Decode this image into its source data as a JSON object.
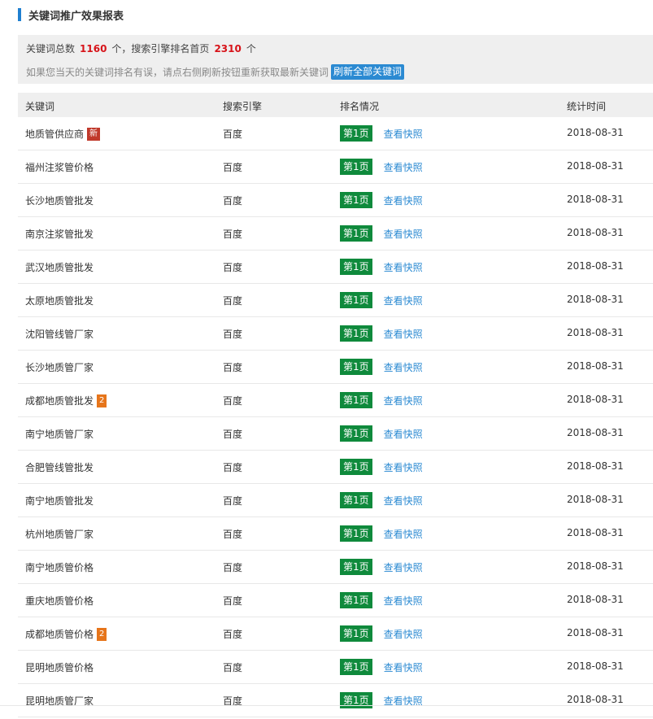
{
  "header": {
    "title": "关键词推广效果报表"
  },
  "summary": {
    "total_prefix": "关键词总数",
    "total_count": "1160",
    "mid_text": "个，搜索引擎排名首页",
    "first_page_count": "2310",
    "suffix": "个",
    "note": "如果您当天的关键词排名有误，请点右侧刷新按钮重新获取最新关键词",
    "refresh_label": "刷新全部关键词"
  },
  "table": {
    "headers": [
      "关键词",
      "搜索引擎",
      "排名情况",
      "统计时间"
    ],
    "snapshot_label": "查看快照",
    "rows": [
      {
        "keyword": "地质管供应商",
        "tag": "新",
        "tag_type": "new",
        "engine": "百度",
        "rank": "第1页",
        "date": "2018-08-31"
      },
      {
        "keyword": "福州注浆管价格",
        "tag": "",
        "engine": "百度",
        "rank": "第1页",
        "date": "2018-08-31"
      },
      {
        "keyword": "长沙地质管批发",
        "tag": "",
        "engine": "百度",
        "rank": "第1页",
        "date": "2018-08-31"
      },
      {
        "keyword": "南京注浆管批发",
        "tag": "",
        "engine": "百度",
        "rank": "第1页",
        "date": "2018-08-31"
      },
      {
        "keyword": "武汉地质管批发",
        "tag": "",
        "engine": "百度",
        "rank": "第1页",
        "date": "2018-08-31"
      },
      {
        "keyword": "太原地质管批发",
        "tag": "",
        "engine": "百度",
        "rank": "第1页",
        "date": "2018-08-31"
      },
      {
        "keyword": "沈阳管线管厂家",
        "tag": "",
        "engine": "百度",
        "rank": "第1页",
        "date": "2018-08-31"
      },
      {
        "keyword": "长沙地质管厂家",
        "tag": "",
        "engine": "百度",
        "rank": "第1页",
        "date": "2018-08-31"
      },
      {
        "keyword": "成都地质管批发",
        "tag": "2",
        "tag_type": "num",
        "engine": "百度",
        "rank": "第1页",
        "date": "2018-08-31"
      },
      {
        "keyword": "南宁地质管厂家",
        "tag": "",
        "engine": "百度",
        "rank": "第1页",
        "date": "2018-08-31"
      },
      {
        "keyword": "合肥管线管批发",
        "tag": "",
        "engine": "百度",
        "rank": "第1页",
        "date": "2018-08-31"
      },
      {
        "keyword": "南宁地质管批发",
        "tag": "",
        "engine": "百度",
        "rank": "第1页",
        "date": "2018-08-31"
      },
      {
        "keyword": "杭州地质管厂家",
        "tag": "",
        "engine": "百度",
        "rank": "第1页",
        "date": "2018-08-31"
      },
      {
        "keyword": "南宁地质管价格",
        "tag": "",
        "engine": "百度",
        "rank": "第1页",
        "date": "2018-08-31"
      },
      {
        "keyword": "重庆地质管价格",
        "tag": "",
        "engine": "百度",
        "rank": "第1页",
        "date": "2018-08-31"
      },
      {
        "keyword": "成都地质管价格",
        "tag": "2",
        "tag_type": "num",
        "engine": "百度",
        "rank": "第1页",
        "date": "2018-08-31"
      },
      {
        "keyword": "昆明地质管价格",
        "tag": "",
        "engine": "百度",
        "rank": "第1页",
        "date": "2018-08-31"
      },
      {
        "keyword": "昆明地质管厂家",
        "tag": "",
        "engine": "百度",
        "rank": "第1页",
        "date": "2018-08-31"
      }
    ]
  },
  "colors": {
    "accent": "#1f7fd0",
    "rank_badge": "#0f8a3c",
    "link": "#2b8ad2",
    "highlight": "#d7141a",
    "tag_new": "#c0392b",
    "tag_num": "#e6751b"
  }
}
